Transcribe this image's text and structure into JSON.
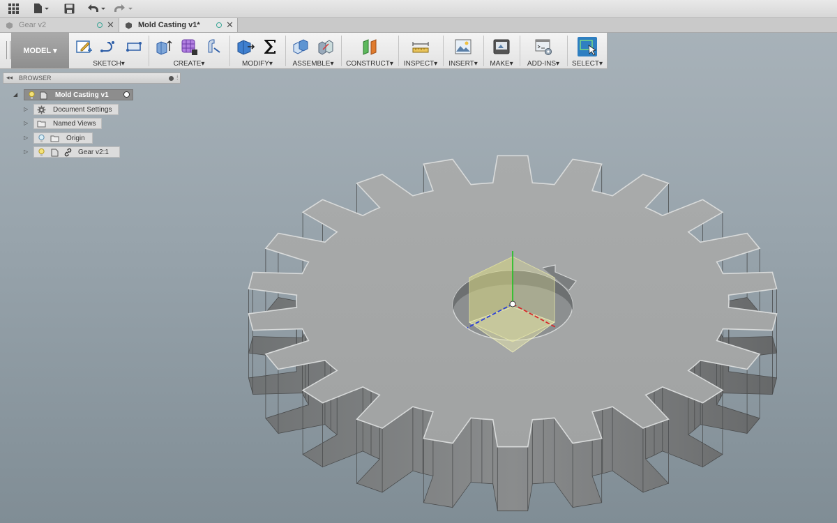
{
  "tabs": [
    {
      "label": "Gear v2",
      "active": false
    },
    {
      "label": "Mold Casting v1*",
      "active": true
    }
  ],
  "toolbar": {
    "workspace": "MODEL",
    "groups": [
      {
        "label": "SKETCH"
      },
      {
        "label": "CREATE"
      },
      {
        "label": "MODIFY"
      },
      {
        "label": "ASSEMBLE"
      },
      {
        "label": "CONSTRUCT"
      },
      {
        "label": "INSPECT"
      },
      {
        "label": "INSERT"
      },
      {
        "label": "MAKE"
      },
      {
        "label": "ADD-INS"
      },
      {
        "label": "SELECT"
      }
    ]
  },
  "browser": {
    "title": "BROWSER",
    "root": "Mold Casting v1",
    "items": [
      {
        "label": "Document Settings"
      },
      {
        "label": "Named Views"
      },
      {
        "label": "Origin"
      },
      {
        "label": "Gear v2:1"
      }
    ]
  },
  "colors": {
    "accent_teal": "#3aa596",
    "select_blue": "#2f7fc1",
    "gear_face": "#a6a8a8",
    "gear_wall": "#7b7d7e"
  }
}
